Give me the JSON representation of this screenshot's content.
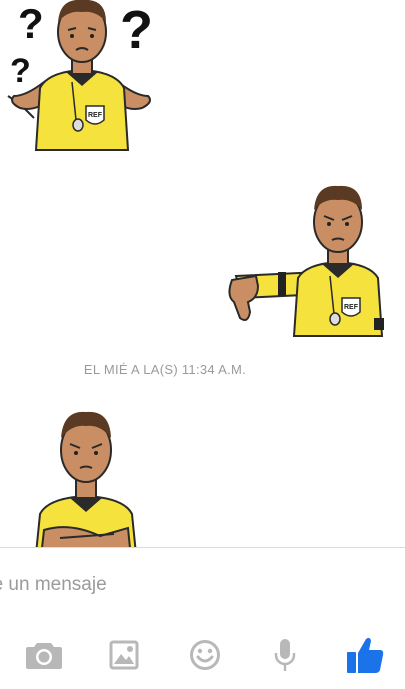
{
  "thread": {
    "stickers": [
      {
        "icon": "confused-referee-sticker"
      },
      {
        "icon": "thumbs-down-referee-sticker"
      },
      {
        "icon": "angry-arms-crossed-referee-sticker"
      }
    ],
    "timestamp": "EL MIÉ A LA(S) 11:34 A.M."
  },
  "composer": {
    "placeholder": "be un mensaje"
  },
  "toolbar": {
    "icons": [
      "camera-icon",
      "gallery-icon",
      "emoji-icon",
      "microphone-icon",
      "like-icon"
    ],
    "icon_color": "#b8b8b8",
    "accent": "#1a73e8"
  },
  "colors": {
    "jersey_yellow": "#f6e23c",
    "skin": "#c98e63",
    "hair": "#5a3a22"
  }
}
